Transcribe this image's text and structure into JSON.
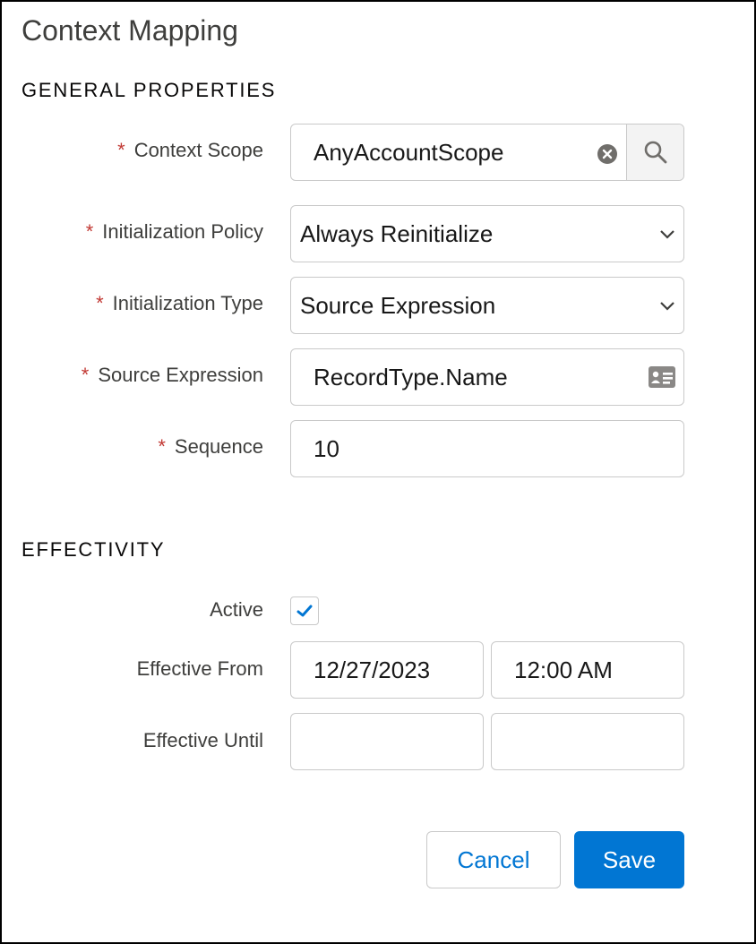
{
  "title": "Context Mapping",
  "general": {
    "heading": "GENERAL PROPERTIES",
    "context_scope": {
      "label": "Context Scope",
      "required": "*",
      "value": "AnyAccountScope"
    },
    "init_policy": {
      "label": "Initialization Policy",
      "required": "*",
      "value": "Always Reinitialize"
    },
    "init_type": {
      "label": "Initialization Type",
      "required": "*",
      "value": "Source Expression"
    },
    "source_expression": {
      "label": "Source Expression",
      "required": "*",
      "value": "RecordType.Name"
    },
    "sequence": {
      "label": "Sequence",
      "required": "*",
      "value": "10"
    }
  },
  "effectivity": {
    "heading": "EFFECTIVITY",
    "active": {
      "label": "Active",
      "checked": true
    },
    "effective_from": {
      "label": "Effective From",
      "date": "12/27/2023",
      "time": "12:00 AM"
    },
    "effective_until": {
      "label": "Effective Until",
      "date": "",
      "time": ""
    }
  },
  "actions": {
    "cancel_label": "Cancel",
    "save_label": "Save"
  },
  "colors": {
    "brand": "#0176d3",
    "required": "#c23934",
    "border": "#c9c9c9"
  },
  "icons": {
    "clear": "clear-icon",
    "search": "search-icon",
    "chevron": "chevron-down-icon",
    "contact_card": "contact-card-icon",
    "check": "check-icon"
  }
}
